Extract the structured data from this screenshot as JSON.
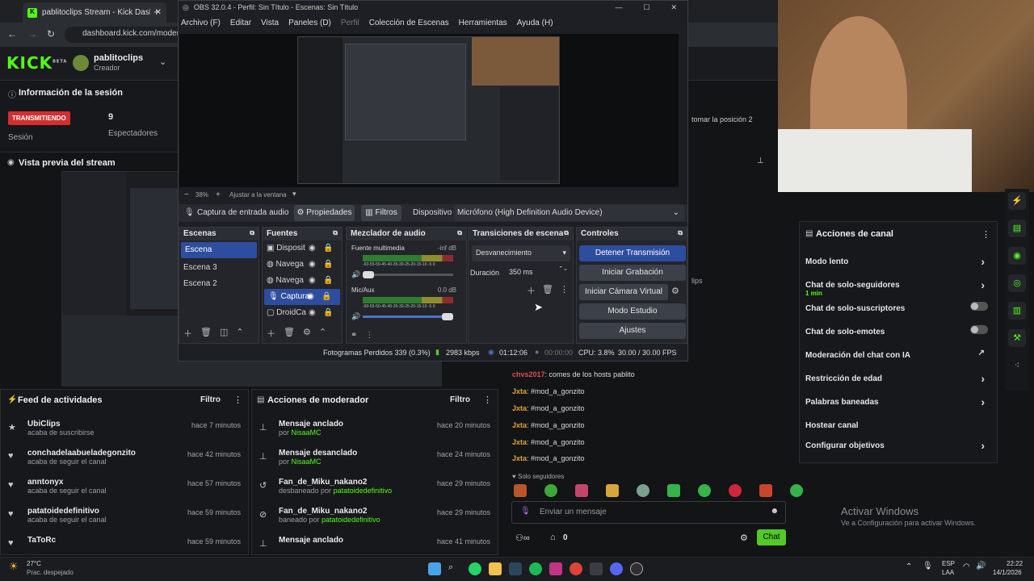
{
  "browser": {
    "tab_title": "pablitoclips Stream - Kick Dash",
    "url": "dashboard.kick.com/moder"
  },
  "kick": {
    "logo": "KICK",
    "beta": "BETA",
    "username": "pablitoclips",
    "role": "Creador",
    "session": {
      "title": "Información de la sesión",
      "live": "TRANSMITIENDO",
      "session_label": "Sesión",
      "viewers": "9",
      "viewers_label": "Espectadores"
    },
    "preview_title": "Vista previa del stream",
    "overlay_text": "tomar la posición 2",
    "clips_text": "lips",
    "feed": {
      "title": "Feed de actividades",
      "filter": "Filtro",
      "items": [
        {
          "name": "UbiClips",
          "action": "acaba de suscribirse",
          "time": "hace 7 minutos",
          "icon": "★"
        },
        {
          "name": "conchadelaabueladegonzito",
          "action": "acaba de seguir el canal",
          "time": "hace 42 minutos",
          "icon": "♥"
        },
        {
          "name": "anntonyx",
          "action": "acaba de seguir el canal",
          "time": "hace 57 minutos",
          "icon": "♥"
        },
        {
          "name": "patatoidedefinitivo",
          "action": "acaba de seguir el canal",
          "time": "hace 59 minutos",
          "icon": "♥"
        },
        {
          "name": "TaToRc",
          "action": "",
          "time": "hace 59 minutos",
          "icon": "♥"
        }
      ]
    },
    "mod": {
      "title": "Acciones de moderador",
      "filter": "Filtro",
      "items": [
        {
          "title": "Mensaje anclado",
          "by": "por ",
          "user": "NisaaMC",
          "time": "hace 20 minutos",
          "icon": "⊥"
        },
        {
          "title": "Mensaje desanclado",
          "by": "por ",
          "user": "NisaaMC",
          "time": "hace 24 minutos",
          "icon": "⊥"
        },
        {
          "title": "Fan_de_Miku_nakano2",
          "by": "desbaneado por ",
          "user": "patatoidedefinitivo",
          "time": "hace 29 minutos",
          "icon": "↺"
        },
        {
          "title": "Fan_de_Miku_nakano2",
          "by": "baneado por ",
          "user": "patatoidedefinitivo",
          "time": "hace 29 minutos",
          "icon": "⊘"
        },
        {
          "title": "Mensaje anclado",
          "by": "",
          "user": "",
          "time": "hace 41 minutos",
          "icon": "⊥"
        }
      ]
    },
    "chat": {
      "messages": [
        {
          "user": "chvs2017",
          "text": ": comes de los hosts pablito"
        },
        {
          "user": "Jxta",
          "text": ": #mod_a_gonzito"
        },
        {
          "user": "Jxta",
          "text": ": #mod_a_gonzito"
        },
        {
          "user": "Jxta",
          "text": ": #mod_a_gonzito"
        },
        {
          "user": "Jxta",
          "text": ": #mod_a_gonzito"
        },
        {
          "user": "Jxta",
          "text": ": #mod_a_gonzito"
        }
      ],
      "followers_only": "Solo seguidores",
      "placeholder": "Enviar un mensaje",
      "count": "0",
      "send": "Chat"
    },
    "channel_actions": {
      "title": "Acciones de canal",
      "items": [
        {
          "label": "Modo lento",
          "sub": "",
          "type": "arrow"
        },
        {
          "label": "Chat de solo-seguidores",
          "sub": "1 min",
          "type": "arrow"
        },
        {
          "label": "Chat de solo-suscriptores",
          "sub": "",
          "type": "toggle"
        },
        {
          "label": "Chat de solo-emotes",
          "sub": "",
          "type": "toggle"
        },
        {
          "label": "Moderación del chat con IA",
          "sub": "",
          "type": "link"
        },
        {
          "label": "Restricción de edad",
          "sub": "",
          "type": "arrow"
        },
        {
          "label": "Palabras baneadas",
          "sub": "",
          "type": "arrow"
        },
        {
          "label": "Hostear canal",
          "sub": "",
          "type": "none"
        },
        {
          "label": "Configurar objetivos",
          "sub": "",
          "type": "arrow"
        }
      ]
    },
    "activate": {
      "title": "Activar Windows",
      "sub": "Ve a Configuración para activar Windows."
    }
  },
  "obs": {
    "title": "OBS 32.0.4 - Perfil: Sin Título - Escenas: Sin Título",
    "menu": [
      "Archivo (F)",
      "Editar",
      "Vista",
      "Paneles (D)",
      "Perfil",
      "Colección de Escenas",
      "Herramientas",
      "Ayuda (H)"
    ],
    "zoom": "38%",
    "fit": "Ajustar a la ventana",
    "source_label": "Captura de entrada audio",
    "props": "Propiedades",
    "filters": "Filtros",
    "device_label": "Dispositivo",
    "device": "Micrófono (High Definition Audio Device)",
    "scenes": {
      "title": "Escenas",
      "items": [
        "Escena",
        "Escena 3",
        "Escena 2"
      ]
    },
    "sources": {
      "title": "Fuentes",
      "items": [
        "Disposit",
        "Navega",
        "Navega",
        "Captura",
        "DroidCa"
      ]
    },
    "mixer": {
      "title": "Mezclador de audio",
      "channels": [
        {
          "name": "Fuente multimedia",
          "db": "-inf dB"
        },
        {
          "name": "Mic/Aux",
          "db": "0.0 dB"
        }
      ],
      "scale": "-60-55-50-45-40-35-30-25-20-15-10 -5 0"
    },
    "transitions": {
      "title": "Transiciones de escena",
      "type": "Desvanecimiento",
      "duration_label": "Duración",
      "duration": "350 ms"
    },
    "controls": {
      "title": "Controles",
      "stop": "Detener Transmisión",
      "record": "Iniciar Grabación",
      "vcam": "Iniciar Cámara Virtual",
      "studio": "Modo Estudio",
      "settings": "Ajustes"
    },
    "status": {
      "dropped": "Fotogramas Perdidos 339 (0.3%)",
      "kbps": "2983 kbps",
      "stream_time": "01:12:06",
      "rec_time": "00:00:00",
      "cpu": "CPU: 3.8%",
      "fps": "30.00 / 30.00 FPS"
    }
  },
  "taskbar": {
    "temp": "27°C",
    "weather": "Prac. despejado",
    "lang": "ESP",
    "lang2": "LAA",
    "time": "22:22",
    "date": "14/1/2026"
  }
}
